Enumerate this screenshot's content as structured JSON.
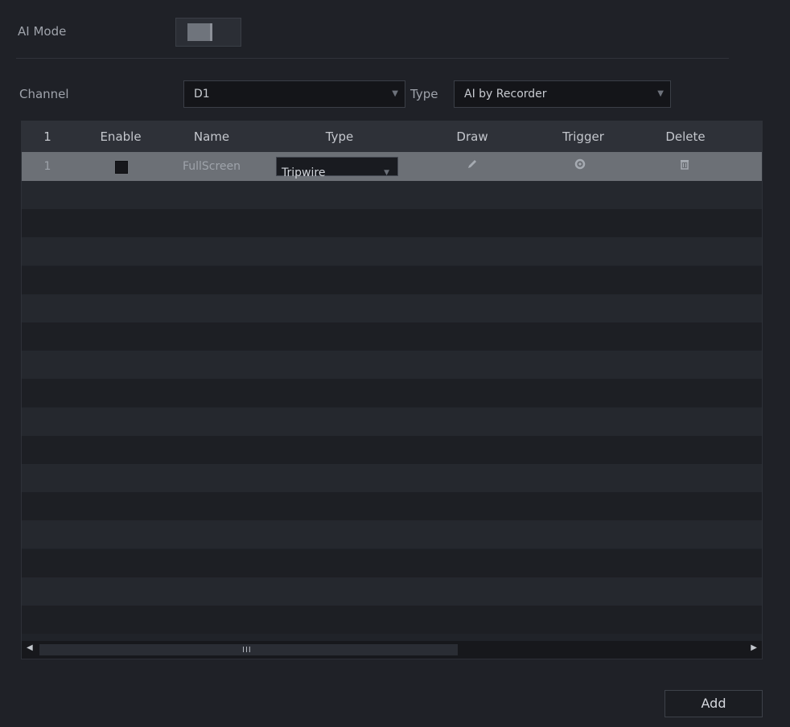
{
  "ai_mode": {
    "label": "AI Mode",
    "enabled": false
  },
  "filters": {
    "channel_label": "Channel",
    "channel_value": "D1",
    "type_label": "Type",
    "type_value": "AI by Recorder"
  },
  "table": {
    "columns": [
      "1",
      "Enable",
      "Name",
      "Type",
      "Draw",
      "Trigger",
      "Delete"
    ],
    "rows": [
      {
        "index": "1",
        "enabled": false,
        "name": "FullScreen",
        "type": "Tripwire",
        "draw_icon": "pencil-icon",
        "trigger_icon": "gear-icon",
        "delete_icon": "trash-icon"
      }
    ]
  },
  "scroll": {
    "grip_glyph": "III"
  },
  "actions": {
    "add_label": "Add"
  }
}
